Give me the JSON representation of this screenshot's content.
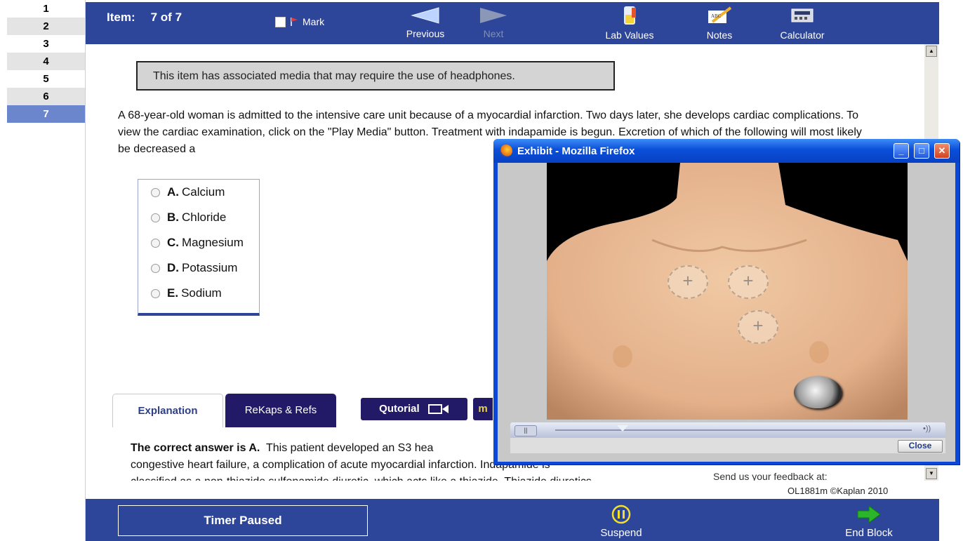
{
  "item_list": [
    "1",
    "2",
    "3",
    "4",
    "5",
    "6",
    "7"
  ],
  "active_item": "7",
  "topbar": {
    "item_label": "Item:",
    "item_count": "7 of 7",
    "mark_label": "Mark",
    "previous_label": "Previous",
    "next_label": "Next",
    "lab_values_label": "Lab Values",
    "notes_label": "Notes",
    "calculator_label": "Calculator"
  },
  "media_note": "This item has associated media that may require the use of headphones.",
  "stem": "A 68-year-old woman is admitted to the intensive care unit because of a myocardial infarction. Two days later, she develops cardiac complications. To view the cardiac examination, click on the \"Play Media\" button. Treatment with indapamide is begun. Excretion of which of the following will most likely be decreased a",
  "choices": [
    {
      "letter": "A.",
      "text": "Calcium"
    },
    {
      "letter": "B.",
      "text": "Chloride"
    },
    {
      "letter": "C.",
      "text": "Magnesium"
    },
    {
      "letter": "D.",
      "text": "Potassium"
    },
    {
      "letter": "E.",
      "text": "Sodium"
    }
  ],
  "tabs": {
    "explanation": "Explanation",
    "rekaps": "ReKaps & Refs",
    "qutorial": "Qutorial",
    "partial_tab": "m"
  },
  "explanation": {
    "lead": "The correct answer is A.",
    "line1": "This patient developed an S3 hea",
    "line2": "congestive heart failure, a complication of acute myocardial infarction. Indapamide is",
    "line3": "classified as a non-thiazide sulfonamide diuretic, which acts like a thiazide. Thiazide diuretics"
  },
  "feedback": "Send us your feedback at:",
  "copyright": "OL1881m ©Kaplan 2010",
  "bottombar": {
    "timer": "Timer Paused",
    "suspend": "Suspend",
    "end_block": "End Block"
  },
  "popup": {
    "title": "Exhibit - Mozilla Firefox",
    "close_label": "Close"
  },
  "colors": {
    "bar_blue": "#2e4699",
    "tab_purple": "#221a66",
    "active_item": "#6b86cc"
  }
}
